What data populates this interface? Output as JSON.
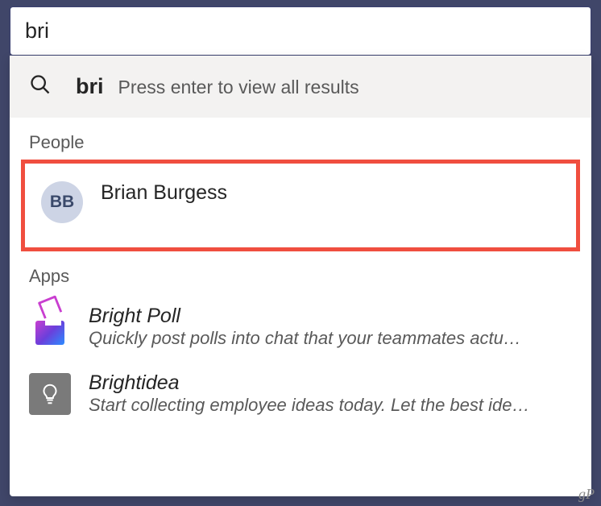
{
  "search": {
    "query": "bri"
  },
  "topRow": {
    "query": "bri",
    "hint": "Press enter to view all results"
  },
  "sections": {
    "people": {
      "label": "People",
      "items": [
        {
          "initials": "BB",
          "name": "Brian Burgess"
        }
      ]
    },
    "apps": {
      "label": "Apps",
      "items": [
        {
          "name": "Bright Poll",
          "desc": "Quickly post polls into chat that your teammates actu…"
        },
        {
          "name": "Brightidea",
          "desc": "Start collecting employee ideas today. Let the best ide…"
        }
      ]
    }
  },
  "watermark": "gP"
}
